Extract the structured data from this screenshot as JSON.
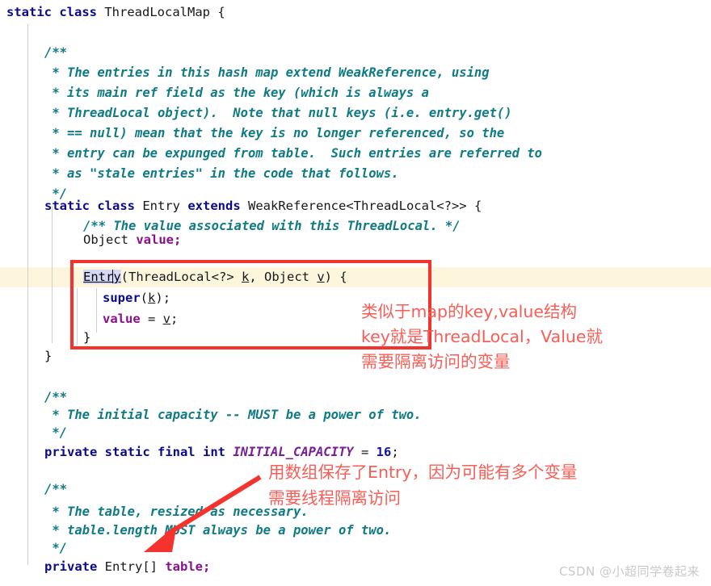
{
  "editor": {
    "language": "java",
    "background_color": "#ffffff",
    "current_line_highlight_color": "#fdf6dd",
    "selection_color": "#d6d9f5",
    "keyword_color": "#0a0a8c",
    "comment_color": "#0f7b84",
    "field_color": "#8a0f8a",
    "constant_color": "#7a1e96",
    "number_color": "#1414a0",
    "annotation_color": "#fa5d56"
  },
  "code": {
    "line_01": "static class ThreadLocalMap {",
    "line_02": "",
    "line_03": "    /**",
    "line_04": "     * The entries in this hash map extend WeakReference, using",
    "line_05": "     * its main ref field as the key (which is always a",
    "line_06": "     * ThreadLocal object).  Note that null keys (i.e. entry.get()",
    "line_07": "     * == null) mean that the key is no longer referenced, so the",
    "line_08": "     * entry can be expunged from table.  Such entries are referred to",
    "line_09": "     * as \"stale entries\" in the code that follows.",
    "line_10": "     */",
    "line_11": "    static class Entry extends WeakReference<ThreadLocal<?>> {",
    "line_12": "        /** The value associated with this ThreadLocal. */",
    "line_13": "        Object value;",
    "line_14": "",
    "line_15": "        Entry(ThreadLocal<?> k, Object v) {",
    "line_16": "            super(k);",
    "line_17": "            value = v;",
    "line_18": "        }",
    "line_19": "    }",
    "line_20": "",
    "line_21": "    /**",
    "line_22": "     * The initial capacity -- MUST be a power of two.",
    "line_23": "     */",
    "line_24": "    private static final int INITIAL_CAPACITY = 16;",
    "line_25": "",
    "line_26": "    /**",
    "line_27": "     * The table, resized as necessary.",
    "line_28": "     * table.length MUST always be a power of two.",
    "line_29": "     */",
    "line_30": "    private Entry[] table;"
  },
  "tokens": {
    "t_static": "static",
    "t_class": "class",
    "t_ThreadLocalMap": " ThreadLocalMap {",
    "c_open": "/**",
    "c_l1": " * The entries in this hash map extend WeakReference, using",
    "c_l2": " * its main ref field as the key (which is always a",
    "c_l3": " * ThreadLocal object).  Note that null keys (i.e. entry.get()",
    "c_l4": " * == null) mean that the key is no longer referenced, so the",
    "c_l5": " * entry can be expunged from table.  Such entries are referred to",
    "c_l6": " * as \"stale entries\" in the code that follows.",
    "c_close": " */",
    "t_entry_name": " Entry ",
    "t_extends": "extends",
    "t_weakref": " WeakReference<ThreadLocal<?>> {",
    "c_value_doc": "/** The value associated with this ThreadLocal. */",
    "t_object": "Object ",
    "t_value_field": "value;",
    "t_entry_sel_a": "Entr",
    "t_entry_sel_b": "y",
    "t_ctor_sig": "(ThreadLocal<?> ",
    "t_param_k": "k",
    "t_ctor_mid": ", Object ",
    "t_param_v": "v",
    "t_ctor_end": ") {",
    "t_super": "super",
    "t_super_open": "(",
    "t_super_close": ");",
    "t_value_assign": "value",
    "t_eq": " = ",
    "t_semi": ";",
    "t_close_brace": "}",
    "t_close_brace_outer": "}",
    "c_cap_doc": " * The initial capacity -- MUST be a power of two.",
    "t_private": "private",
    "t_static2": " static ",
    "t_final": "final",
    "t_int": " int ",
    "t_INITIAL_CAPACITY": "INITIAL_CAPACITY",
    "t_eq2": " = ",
    "t_16": "16",
    "t_semi2": ";",
    "c_table_doc1": " * The table, resized as necessary.",
    "c_table_doc2": " * table.length MUST always be a power of two.",
    "t_private2": "private",
    "t_entry_arr": " Entry[] ",
    "t_table": "table;"
  },
  "annotations": {
    "box_note_line1": "类似于map的key,value结构",
    "box_note_line2": "key就是ThreadLocal，Value就",
    "box_note_line3": "需要隔离访问的变量",
    "table_note_line1": "用数组保存了Entry，因为可能有多个变量",
    "table_note_line2": "需要线程隔离访问"
  },
  "watermark": {
    "text": "CSDN @小超同学卷起来"
  }
}
